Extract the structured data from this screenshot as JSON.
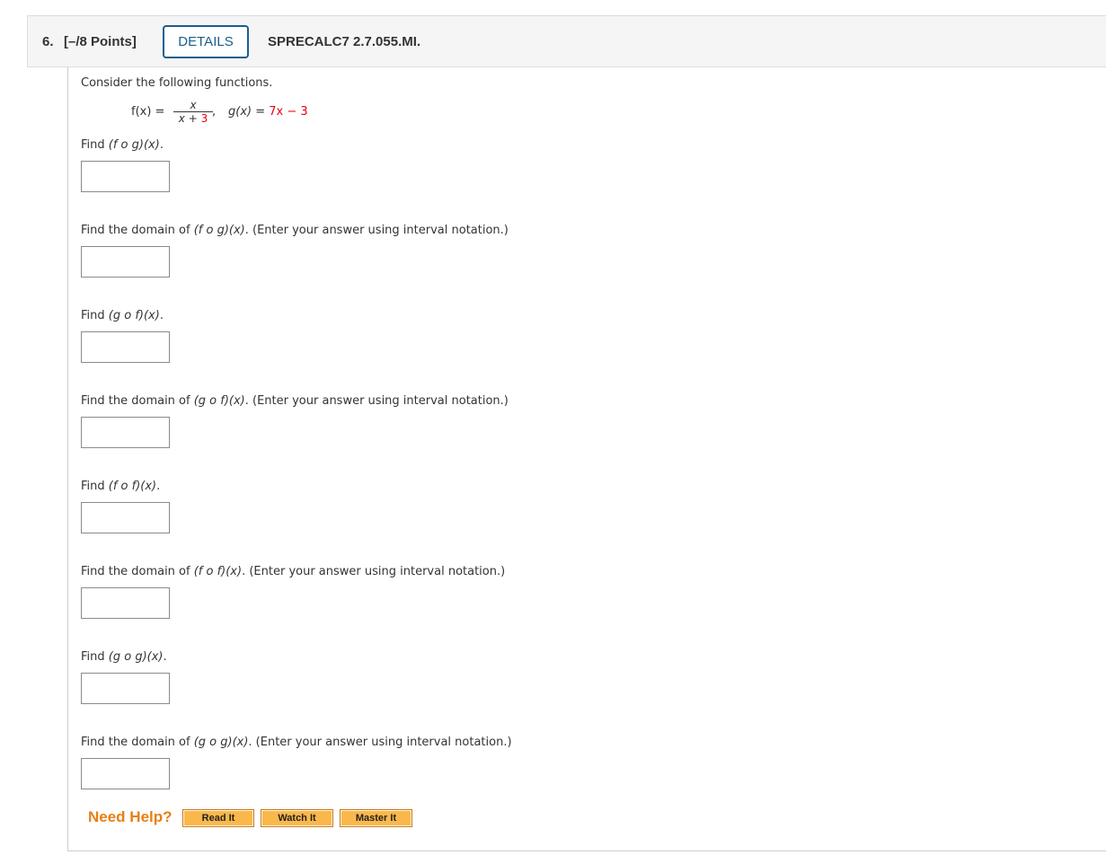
{
  "header": {
    "question_number": "6.",
    "points": "[–/8 Points]",
    "details_label": "DETAILS",
    "question_code": "SPRECALC7 2.7.055.MI."
  },
  "problem": {
    "intro": "Consider the following functions.",
    "f_label": "f(x) =",
    "f_numerator": "x",
    "f_denominator_var": "x + ",
    "f_denominator_const": "3",
    "f_trailing": ",",
    "g_label": "g(x) = ",
    "g_expr": "7x − 3"
  },
  "parts": [
    {
      "prefix": "Find ",
      "expr": "(f o g)(x)",
      "suffix": ".",
      "answer": ""
    },
    {
      "prefix": "Find the domain of ",
      "expr": "(f o g)(x)",
      "suffix": ".  (Enter your answer using interval notation.)",
      "answer": ""
    },
    {
      "prefix": "Find ",
      "expr": "(g o f)(x)",
      "suffix": ".",
      "answer": ""
    },
    {
      "prefix": "Find the domain of ",
      "expr": "(g o f)(x)",
      "suffix": ".  (Enter your answer using interval notation.)",
      "answer": ""
    },
    {
      "prefix": "Find ",
      "expr": "(f o f)(x)",
      "suffix": ".",
      "answer": ""
    },
    {
      "prefix": "Find the domain of ",
      "expr": "(f o f)(x)",
      "suffix": ".  (Enter your answer using interval notation.)",
      "answer": ""
    },
    {
      "prefix": "Find ",
      "expr": "(g o g)(x)",
      "suffix": ".",
      "answer": ""
    },
    {
      "prefix": "Find the domain of ",
      "expr": "(g o g)(x)",
      "suffix": ".  (Enter your answer using interval notation.)",
      "answer": ""
    }
  ],
  "help": {
    "label": "Need Help?",
    "buttons": [
      "Read It",
      "Watch It",
      "Master It"
    ]
  },
  "colors": {
    "accent": "#1a5e8e",
    "help_orange": "#e87f12",
    "button_fill": "#fbb84a",
    "highlight_red": "#e8000b"
  }
}
